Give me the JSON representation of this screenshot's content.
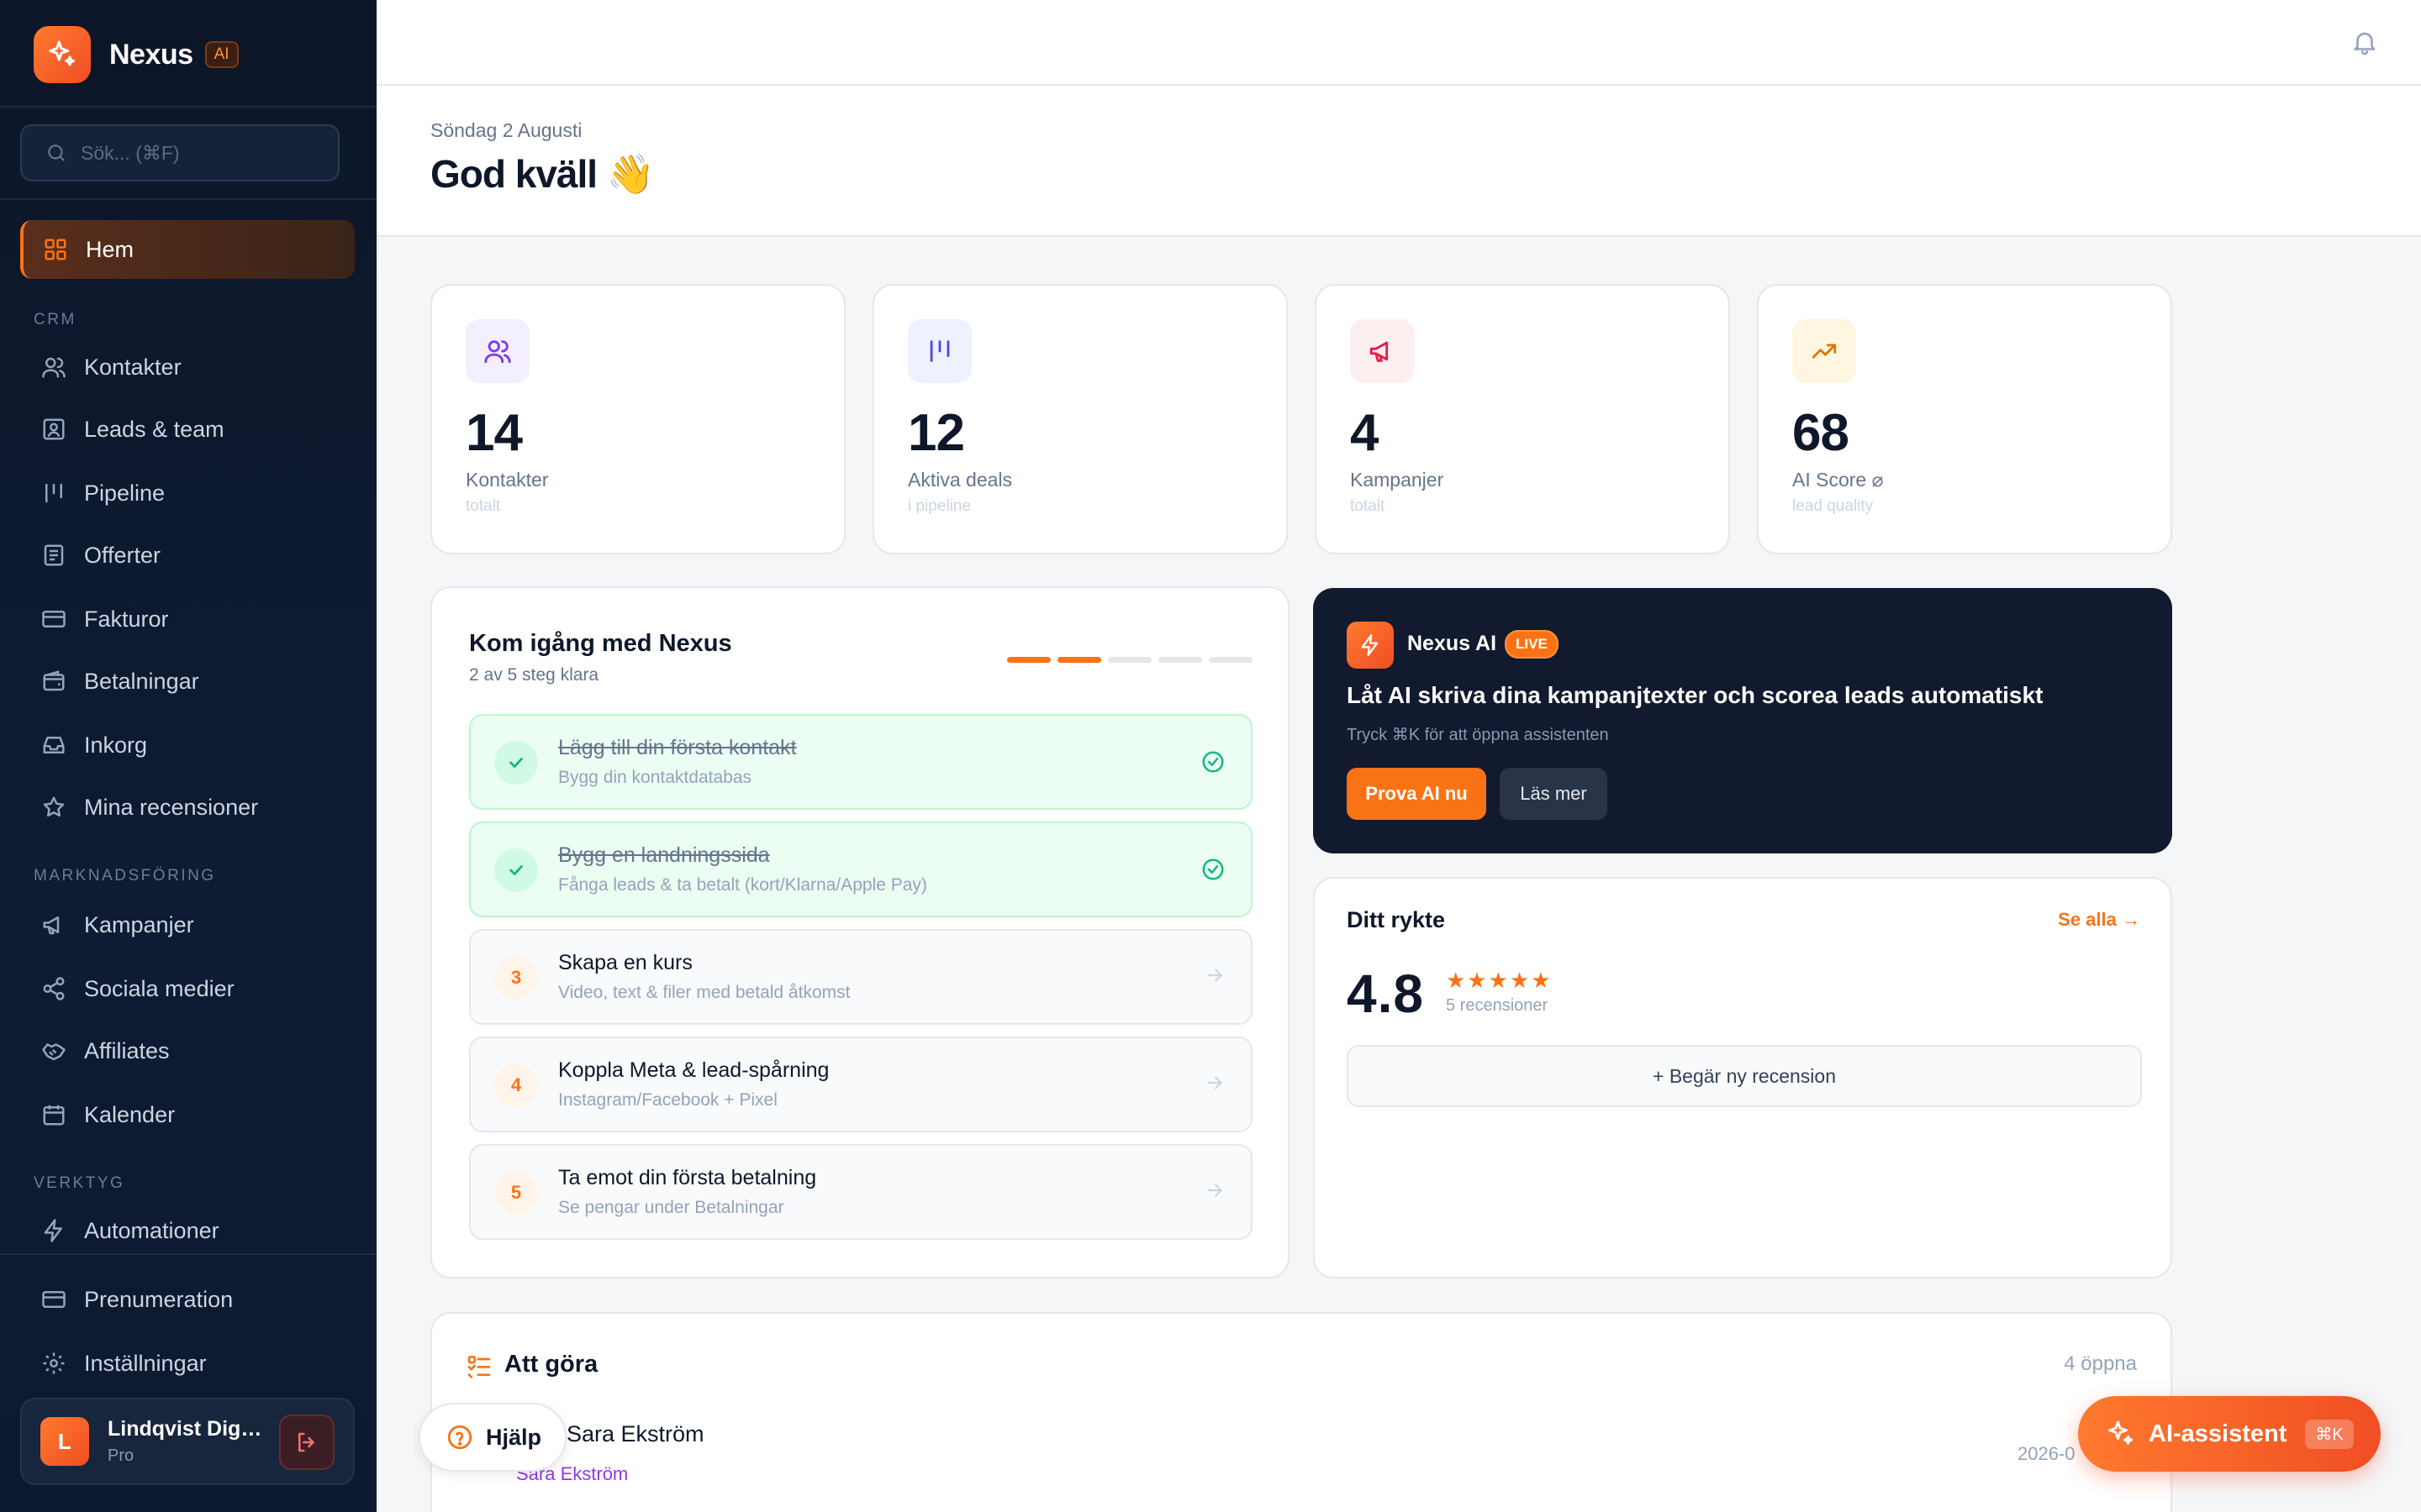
{
  "brand": {
    "name": "Nexus",
    "badge": "AI"
  },
  "search": {
    "placeholder": "Sök... (⌘F)"
  },
  "nav": {
    "home": "Hem",
    "section_crm": "CRM",
    "crm": [
      "Kontakter",
      "Leads & team",
      "Pipeline",
      "Offerter",
      "Fakturor",
      "Betalningar",
      "Inkorg",
      "Mina recensioner"
    ],
    "section_marketing": "MARKNADSFÖRING",
    "marketing": [
      "Kampanjer",
      "Sociala medier",
      "Affiliates",
      "Kalender"
    ],
    "section_tools": "VERKTYG",
    "tools": [
      "Automationer"
    ],
    "bottom": [
      "Prenumeration",
      "Inställningar"
    ]
  },
  "user": {
    "initial": "L",
    "name": "Lindqvist Digit...",
    "plan": "Pro"
  },
  "header": {
    "date": "Söndag 2 Augusti",
    "greeting": "God kväll 👋"
  },
  "stats": [
    {
      "value": "14",
      "label": "Kontakter",
      "sub": "totalt",
      "icon": "users-icon",
      "bg": "#f3effe",
      "color": "#7c3aed"
    },
    {
      "value": "12",
      "label": "Aktiva deals",
      "sub": "i pipeline",
      "icon": "pipeline-icon",
      "bg": "#eef2ff",
      "color": "#4f46e5"
    },
    {
      "value": "4",
      "label": "Kampanjer",
      "sub": "totalt",
      "icon": "megaphone-icon",
      "bg": "#fdeef0",
      "color": "#e11d48"
    },
    {
      "value": "68",
      "label": "AI Score ⌀",
      "sub": "lead quality",
      "icon": "trending-up-icon",
      "bg": "#fef6e0",
      "color": "#d97706"
    }
  ],
  "onboarding": {
    "title": "Kom igång med Nexus",
    "progress_text": "2 av 5 steg klara",
    "progress": {
      "done": 2,
      "total": 5
    },
    "steps": [
      {
        "number": "1",
        "title": "Lägg till din första kontakt",
        "desc": "Bygg din kontaktdatabas",
        "done": true
      },
      {
        "number": "2",
        "title": "Bygg en landningssida",
        "desc": "Fånga leads & ta betalt (kort/Klarna/Apple Pay)",
        "done": true
      },
      {
        "number": "3",
        "title": "Skapa en kurs",
        "desc": "Video, text & filer med betald åtkomst",
        "done": false
      },
      {
        "number": "4",
        "title": "Koppla Meta & lead-spårning",
        "desc": "Instagram/Facebook + Pixel",
        "done": false
      },
      {
        "number": "5",
        "title": "Ta emot din första betalning",
        "desc": "Se pengar under Betalningar",
        "done": false
      }
    ]
  },
  "ai_card": {
    "name": "Nexus AI",
    "badge": "LIVE",
    "headline": "Låt AI skriva dina kampanjtexter och scorea leads automatiskt",
    "sub": "Tryck ⌘K för att öppna assistenten",
    "primary": "Prova AI nu",
    "secondary": "Läs mer"
  },
  "reputation": {
    "title": "Ditt rykte",
    "link": "Se alla →",
    "score": "4.8",
    "stars": "★★★★★",
    "rating": 4.8,
    "count": "5 recensioner",
    "button": "+ Begär ny recension"
  },
  "todo": {
    "title": "Att göra",
    "count": "4 öppna",
    "first_item": {
      "name": "Sara Ekström",
      "contact": "Sara Ekström",
      "date": "2026-0"
    }
  },
  "help": {
    "label": "Hjälp"
  },
  "ai_assistant": {
    "label": "AI-assistent",
    "shortcut": "⌘K"
  },
  "colors": {
    "accent": "#f97316",
    "sidebar": "#0c1628",
    "success": "#10b981"
  }
}
